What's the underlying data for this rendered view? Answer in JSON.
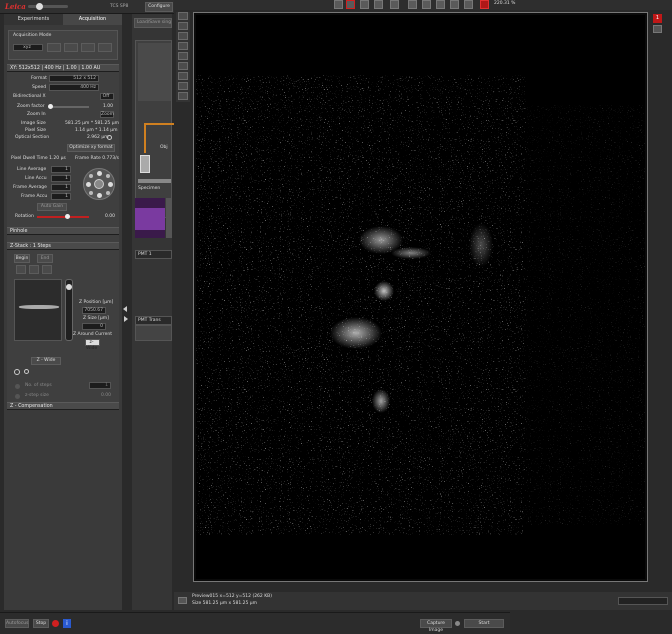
{
  "header": {
    "logo": "Leica",
    "tcs_label": "TCS SP8",
    "configure_label": "Configure"
  },
  "left_panel": {
    "tabs": [
      {
        "label": "Experiments"
      },
      {
        "label": "Acquisition"
      }
    ],
    "acquisition_mode": {
      "label": "Acquisition Mode",
      "mode_value": "xyz"
    },
    "scan_section": {
      "title": "XY: 512x512 | 400 Hz | 1.00 | 1.00 AU",
      "format": {
        "label": "Format",
        "value": "512 x 512"
      },
      "speed": {
        "label": "Speed",
        "value": "400 Hz"
      },
      "bidirectional": {
        "label": "Bidirectional X",
        "value": "Off"
      },
      "zoom_factor": {
        "label": "Zoom factor",
        "value": "1.00"
      },
      "zoom_in": {
        "label": "Zoom In",
        "value": "Zoom"
      },
      "image_size": {
        "label": "Image Size",
        "value": "581.25 µm * 581.25 µm"
      },
      "pixel_size": {
        "label": "Pixel Size",
        "value": "1.14 µm * 1.14 µm"
      },
      "optical_section": {
        "label": "Optical Section",
        "value": "2.962 µm"
      },
      "optimize_button": "Optimize xy format",
      "pixel_dwell": {
        "label": "Pixel Dwell Time",
        "value": "1.20 µs"
      },
      "frame_rate": {
        "label": "Frame Rate",
        "value": "0.773/s"
      },
      "line_average": {
        "label": "Line Average",
        "value": "1"
      },
      "line_accu": {
        "label": "Line Accu",
        "value": "1"
      },
      "frame_average": {
        "label": "Frame Average",
        "value": "1"
      },
      "frame_accu": {
        "label": "Frame Accu",
        "value": "1"
      },
      "auto_gain": "Auto Gain",
      "rotation": {
        "label": "Rotation",
        "value": "0.00"
      },
      "pinhole_label": "Pinhole"
    },
    "zstack_section": {
      "title": "Z-Stack : 1 Steps",
      "begin_button": "Begin",
      "end_button": "End",
      "z_position": {
        "label": "Z Position [µm]",
        "value": "7050.67"
      },
      "z_size": {
        "label": "Z Size [µm]",
        "value": "0"
      },
      "z_around": {
        "label": "Z Around Current",
        "value": "z-Wide"
      },
      "z_drive": "Z - Wide",
      "no_of_steps": {
        "label": "No. of steps",
        "value": "1"
      },
      "z_step_size": {
        "label": "z-step size",
        "value": "0.00"
      },
      "system_optimized": "System Optimized",
      "z_compensation": "Z - Compensation"
    }
  },
  "middle_panel": {
    "title": "Load/Save single setting",
    "objective_label": "Obj",
    "specimen_label": "Specimen",
    "pmt1_label": "PMT 1",
    "pmt_trans_label": "PMT Trans"
  },
  "viewer": {
    "zoom_readout": "220.31 %",
    "status_line1": "Preview015 x=512 y=512 (262 KB)",
    "status_line2": "Size 581.25 µm x 581.25 µm",
    "top_toolbar_icons": [
      "select-icon",
      "pointer-icon",
      "crop-icon",
      "rotate-icon",
      "measure-icon",
      "line-icon",
      "move-icon",
      "pan-icon",
      "zoom-icon",
      "zoom-fit-icon",
      "zoom-out-icon",
      "fullscreen-icon"
    ],
    "side_toolbar_icons": [
      "channel-icon",
      "overlay-icon",
      "lut-icon",
      "grid-icon",
      "scale-icon",
      "text-icon",
      "max-proj-icon",
      "profile-icon",
      "histogram-icon"
    ],
    "right_icons": {
      "notification_count": "1"
    }
  },
  "bottom_bar": {
    "autofocus_button": "Autofocus",
    "stop_button": "Stop",
    "capture_button": "Capture Image",
    "start_button": "Start"
  },
  "colors": {
    "app_bg": "#2a2a2a",
    "panel_bg": "#3a3a3a",
    "accent_red": "#d02020",
    "image_bg": "#000000"
  }
}
